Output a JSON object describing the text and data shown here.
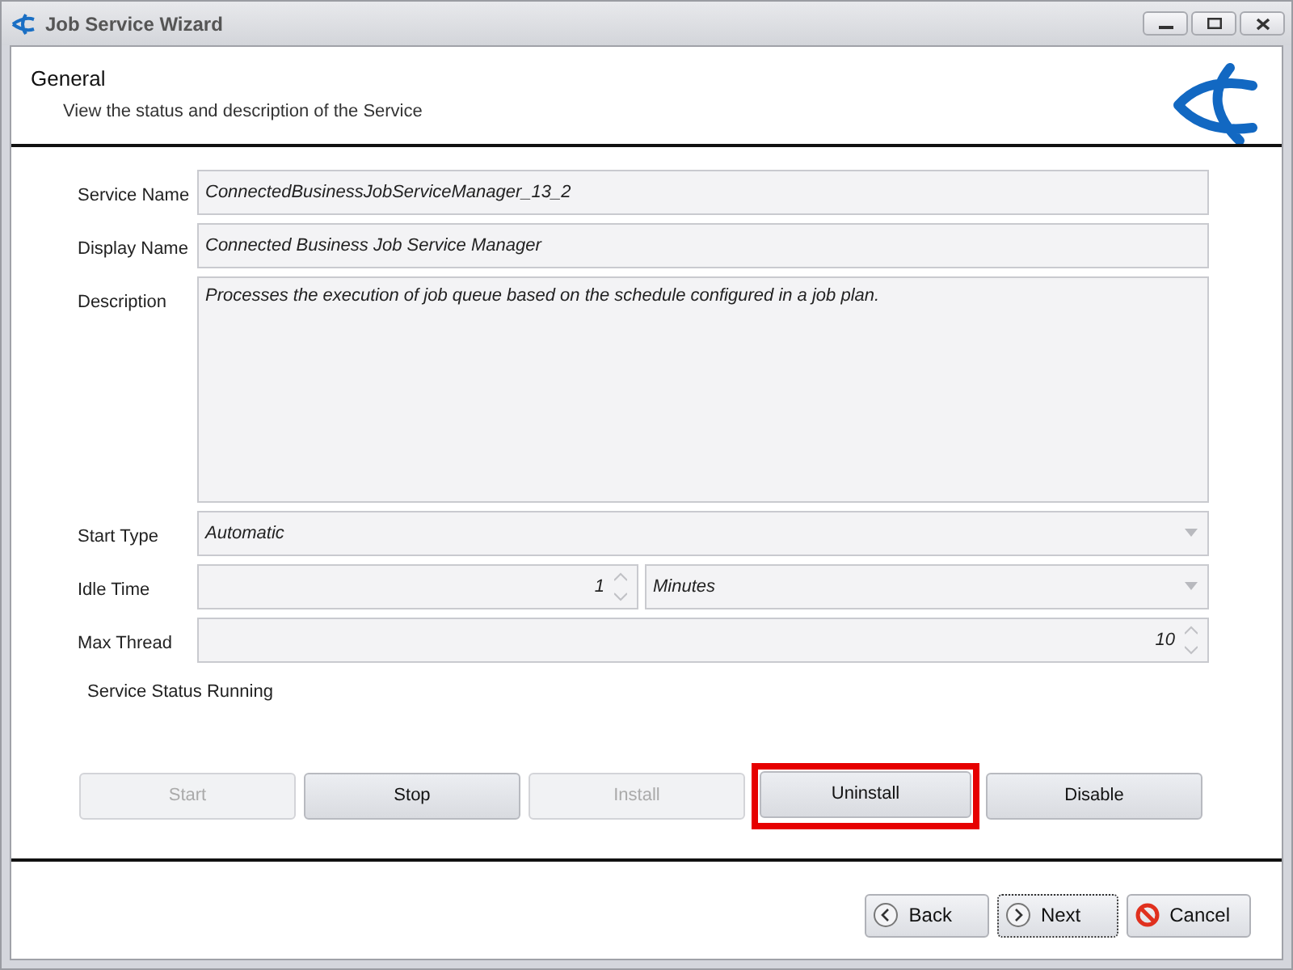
{
  "window": {
    "title": "Job Service Wizard"
  },
  "header": {
    "title": "General",
    "subtitle": "View the status and description of the Service"
  },
  "fields": [
    {
      "kind": "text",
      "label": "Service Name",
      "value": "ConnectedBusinessJobServiceManager_13_2"
    },
    {
      "kind": "text",
      "label": "Display Name",
      "value": "Connected Business Job Service Manager"
    },
    {
      "kind": "memo",
      "label": "Description",
      "value": "Processes the execution of job queue based on the schedule configured in a job plan."
    },
    {
      "kind": "combo",
      "label": "Start Type",
      "value": "Automatic"
    },
    {
      "kind": "spin-combo",
      "label": "Idle Time",
      "value": "1",
      "unit": "Minutes"
    },
    {
      "kind": "spin",
      "label": "Max Thread",
      "value": "10"
    }
  ],
  "status": "Service Status Running",
  "actions": [
    {
      "label": "Start",
      "disabled": true,
      "highlighted": false
    },
    {
      "label": "Stop",
      "disabled": false,
      "highlighted": false
    },
    {
      "label": "Install",
      "disabled": true,
      "highlighted": false
    },
    {
      "label": "Uninstall",
      "disabled": false,
      "highlighted": true
    },
    {
      "label": "Disable",
      "disabled": false,
      "highlighted": false
    }
  ],
  "nav_buttons": [
    {
      "kind": "back",
      "label": "Back",
      "focused": false
    },
    {
      "kind": "next",
      "label": "Next",
      "focused": true
    },
    {
      "kind": "cancel",
      "label": "Cancel",
      "focused": false
    }
  ]
}
